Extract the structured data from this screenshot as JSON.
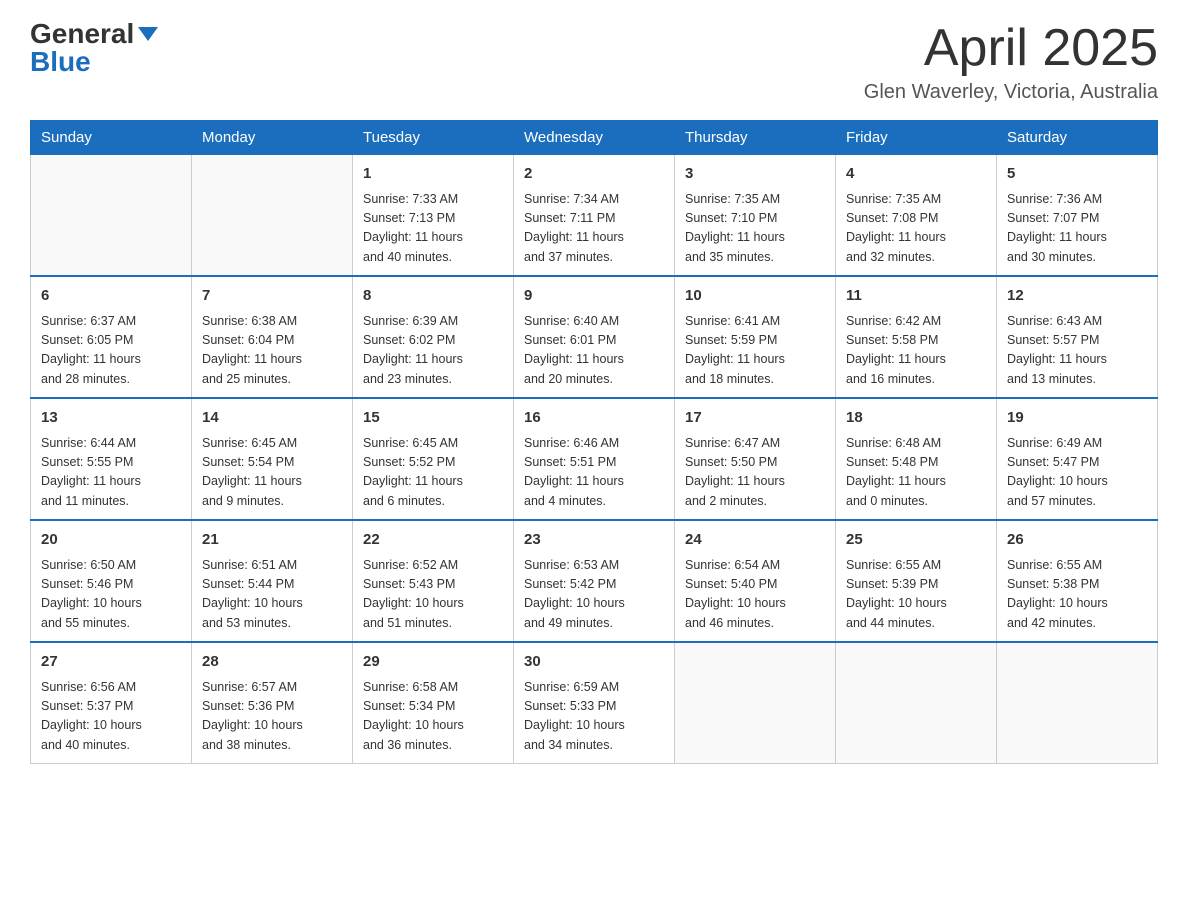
{
  "header": {
    "logo": {
      "general": "General",
      "blue": "Blue",
      "tagline": "GeneralBlue"
    },
    "title": "April 2025",
    "location": "Glen Waverley, Victoria, Australia"
  },
  "weekdays": [
    "Sunday",
    "Monday",
    "Tuesday",
    "Wednesday",
    "Thursday",
    "Friday",
    "Saturday"
  ],
  "weeks": [
    [
      {
        "day": "",
        "info": ""
      },
      {
        "day": "",
        "info": ""
      },
      {
        "day": "1",
        "info": "Sunrise: 7:33 AM\nSunset: 7:13 PM\nDaylight: 11 hours\nand 40 minutes."
      },
      {
        "day": "2",
        "info": "Sunrise: 7:34 AM\nSunset: 7:11 PM\nDaylight: 11 hours\nand 37 minutes."
      },
      {
        "day": "3",
        "info": "Sunrise: 7:35 AM\nSunset: 7:10 PM\nDaylight: 11 hours\nand 35 minutes."
      },
      {
        "day": "4",
        "info": "Sunrise: 7:35 AM\nSunset: 7:08 PM\nDaylight: 11 hours\nand 32 minutes."
      },
      {
        "day": "5",
        "info": "Sunrise: 7:36 AM\nSunset: 7:07 PM\nDaylight: 11 hours\nand 30 minutes."
      }
    ],
    [
      {
        "day": "6",
        "info": "Sunrise: 6:37 AM\nSunset: 6:05 PM\nDaylight: 11 hours\nand 28 minutes."
      },
      {
        "day": "7",
        "info": "Sunrise: 6:38 AM\nSunset: 6:04 PM\nDaylight: 11 hours\nand 25 minutes."
      },
      {
        "day": "8",
        "info": "Sunrise: 6:39 AM\nSunset: 6:02 PM\nDaylight: 11 hours\nand 23 minutes."
      },
      {
        "day": "9",
        "info": "Sunrise: 6:40 AM\nSunset: 6:01 PM\nDaylight: 11 hours\nand 20 minutes."
      },
      {
        "day": "10",
        "info": "Sunrise: 6:41 AM\nSunset: 5:59 PM\nDaylight: 11 hours\nand 18 minutes."
      },
      {
        "day": "11",
        "info": "Sunrise: 6:42 AM\nSunset: 5:58 PM\nDaylight: 11 hours\nand 16 minutes."
      },
      {
        "day": "12",
        "info": "Sunrise: 6:43 AM\nSunset: 5:57 PM\nDaylight: 11 hours\nand 13 minutes."
      }
    ],
    [
      {
        "day": "13",
        "info": "Sunrise: 6:44 AM\nSunset: 5:55 PM\nDaylight: 11 hours\nand 11 minutes."
      },
      {
        "day": "14",
        "info": "Sunrise: 6:45 AM\nSunset: 5:54 PM\nDaylight: 11 hours\nand 9 minutes."
      },
      {
        "day": "15",
        "info": "Sunrise: 6:45 AM\nSunset: 5:52 PM\nDaylight: 11 hours\nand 6 minutes."
      },
      {
        "day": "16",
        "info": "Sunrise: 6:46 AM\nSunset: 5:51 PM\nDaylight: 11 hours\nand 4 minutes."
      },
      {
        "day": "17",
        "info": "Sunrise: 6:47 AM\nSunset: 5:50 PM\nDaylight: 11 hours\nand 2 minutes."
      },
      {
        "day": "18",
        "info": "Sunrise: 6:48 AM\nSunset: 5:48 PM\nDaylight: 11 hours\nand 0 minutes."
      },
      {
        "day": "19",
        "info": "Sunrise: 6:49 AM\nSunset: 5:47 PM\nDaylight: 10 hours\nand 57 minutes."
      }
    ],
    [
      {
        "day": "20",
        "info": "Sunrise: 6:50 AM\nSunset: 5:46 PM\nDaylight: 10 hours\nand 55 minutes."
      },
      {
        "day": "21",
        "info": "Sunrise: 6:51 AM\nSunset: 5:44 PM\nDaylight: 10 hours\nand 53 minutes."
      },
      {
        "day": "22",
        "info": "Sunrise: 6:52 AM\nSunset: 5:43 PM\nDaylight: 10 hours\nand 51 minutes."
      },
      {
        "day": "23",
        "info": "Sunrise: 6:53 AM\nSunset: 5:42 PM\nDaylight: 10 hours\nand 49 minutes."
      },
      {
        "day": "24",
        "info": "Sunrise: 6:54 AM\nSunset: 5:40 PM\nDaylight: 10 hours\nand 46 minutes."
      },
      {
        "day": "25",
        "info": "Sunrise: 6:55 AM\nSunset: 5:39 PM\nDaylight: 10 hours\nand 44 minutes."
      },
      {
        "day": "26",
        "info": "Sunrise: 6:55 AM\nSunset: 5:38 PM\nDaylight: 10 hours\nand 42 minutes."
      }
    ],
    [
      {
        "day": "27",
        "info": "Sunrise: 6:56 AM\nSunset: 5:37 PM\nDaylight: 10 hours\nand 40 minutes."
      },
      {
        "day": "28",
        "info": "Sunrise: 6:57 AM\nSunset: 5:36 PM\nDaylight: 10 hours\nand 38 minutes."
      },
      {
        "day": "29",
        "info": "Sunrise: 6:58 AM\nSunset: 5:34 PM\nDaylight: 10 hours\nand 36 minutes."
      },
      {
        "day": "30",
        "info": "Sunrise: 6:59 AM\nSunset: 5:33 PM\nDaylight: 10 hours\nand 34 minutes."
      },
      {
        "day": "",
        "info": ""
      },
      {
        "day": "",
        "info": ""
      },
      {
        "day": "",
        "info": ""
      }
    ]
  ]
}
